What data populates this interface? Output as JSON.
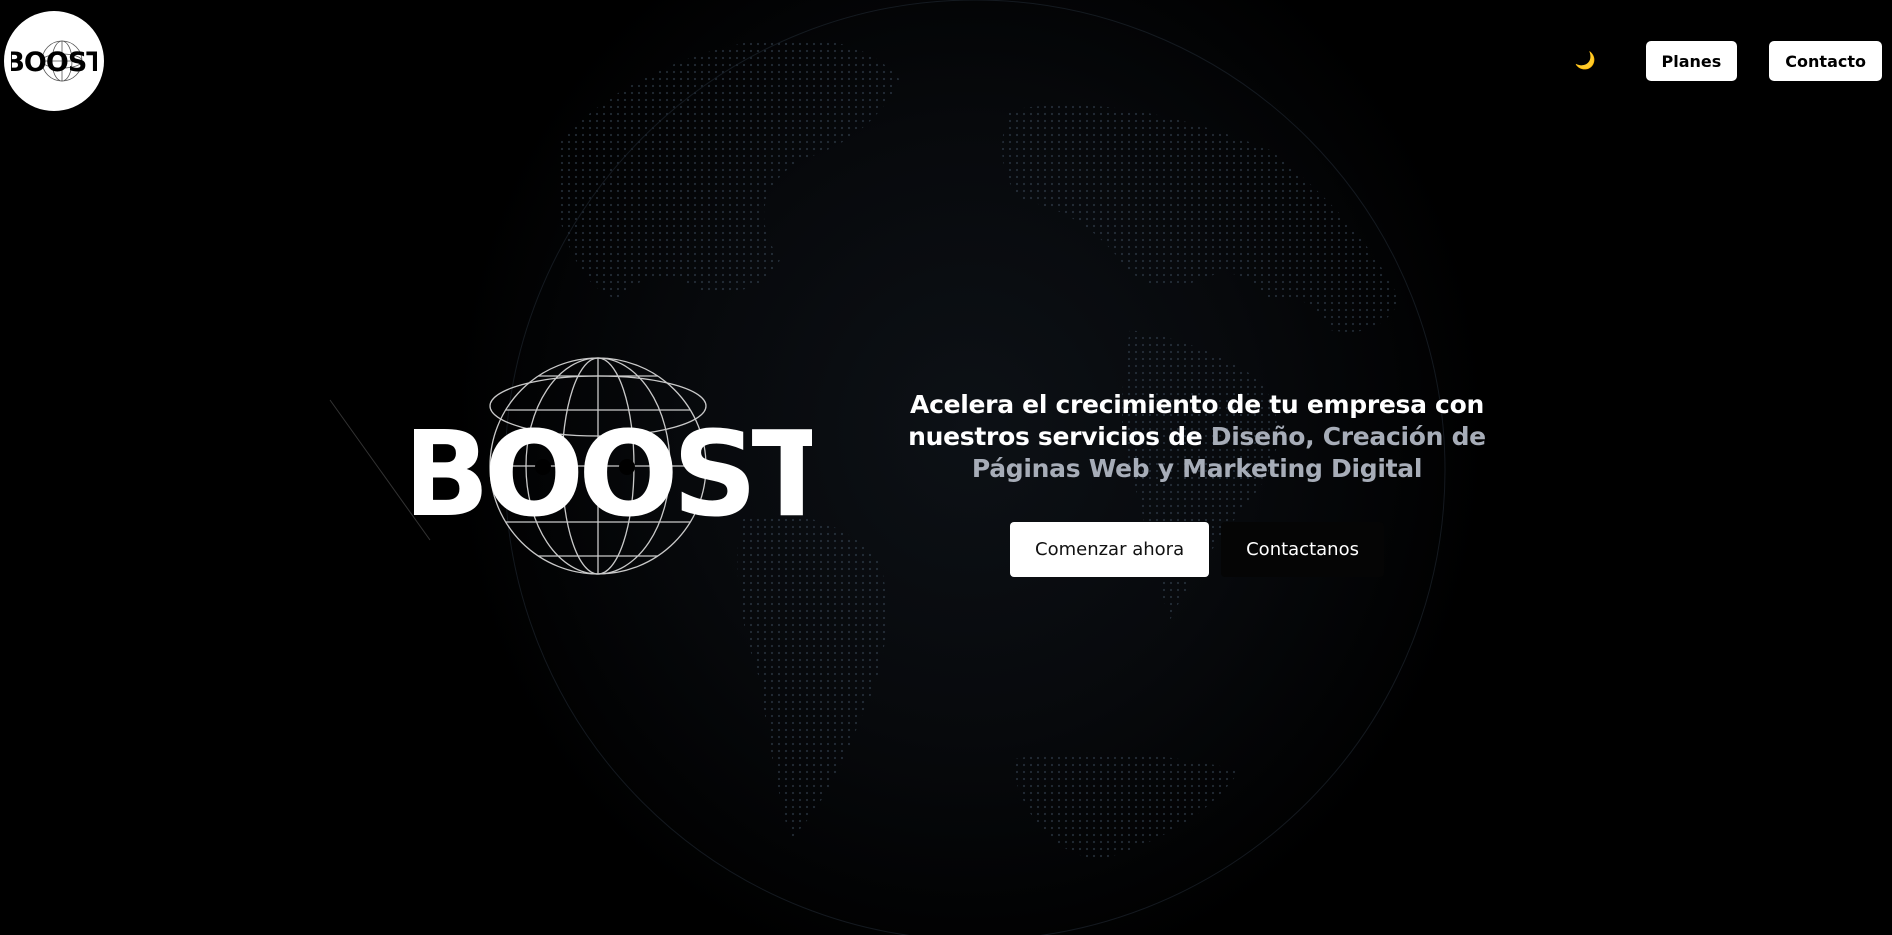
{
  "brand": {
    "logo_text": "BOOST"
  },
  "header": {
    "theme_toggle_icon": "moon-icon",
    "theme_toggle_glyph": "🌙",
    "nav": [
      {
        "label": "Planes"
      },
      {
        "label": "Contacto"
      }
    ]
  },
  "hero": {
    "logo_text": "BOOST",
    "headline_plain": "Acelera el crecimiento de tu empresa con nuestros servicios de ",
    "headline_accent": "Diseño, Creación de Páginas Web y Marketing Digital",
    "primary_cta": "Comenzar ahora",
    "secondary_cta": "Contactanos"
  },
  "colors": {
    "background": "#000000",
    "accent_text": "#a7adb8",
    "button_bg": "#ffffff",
    "moon": "#f4c430"
  }
}
